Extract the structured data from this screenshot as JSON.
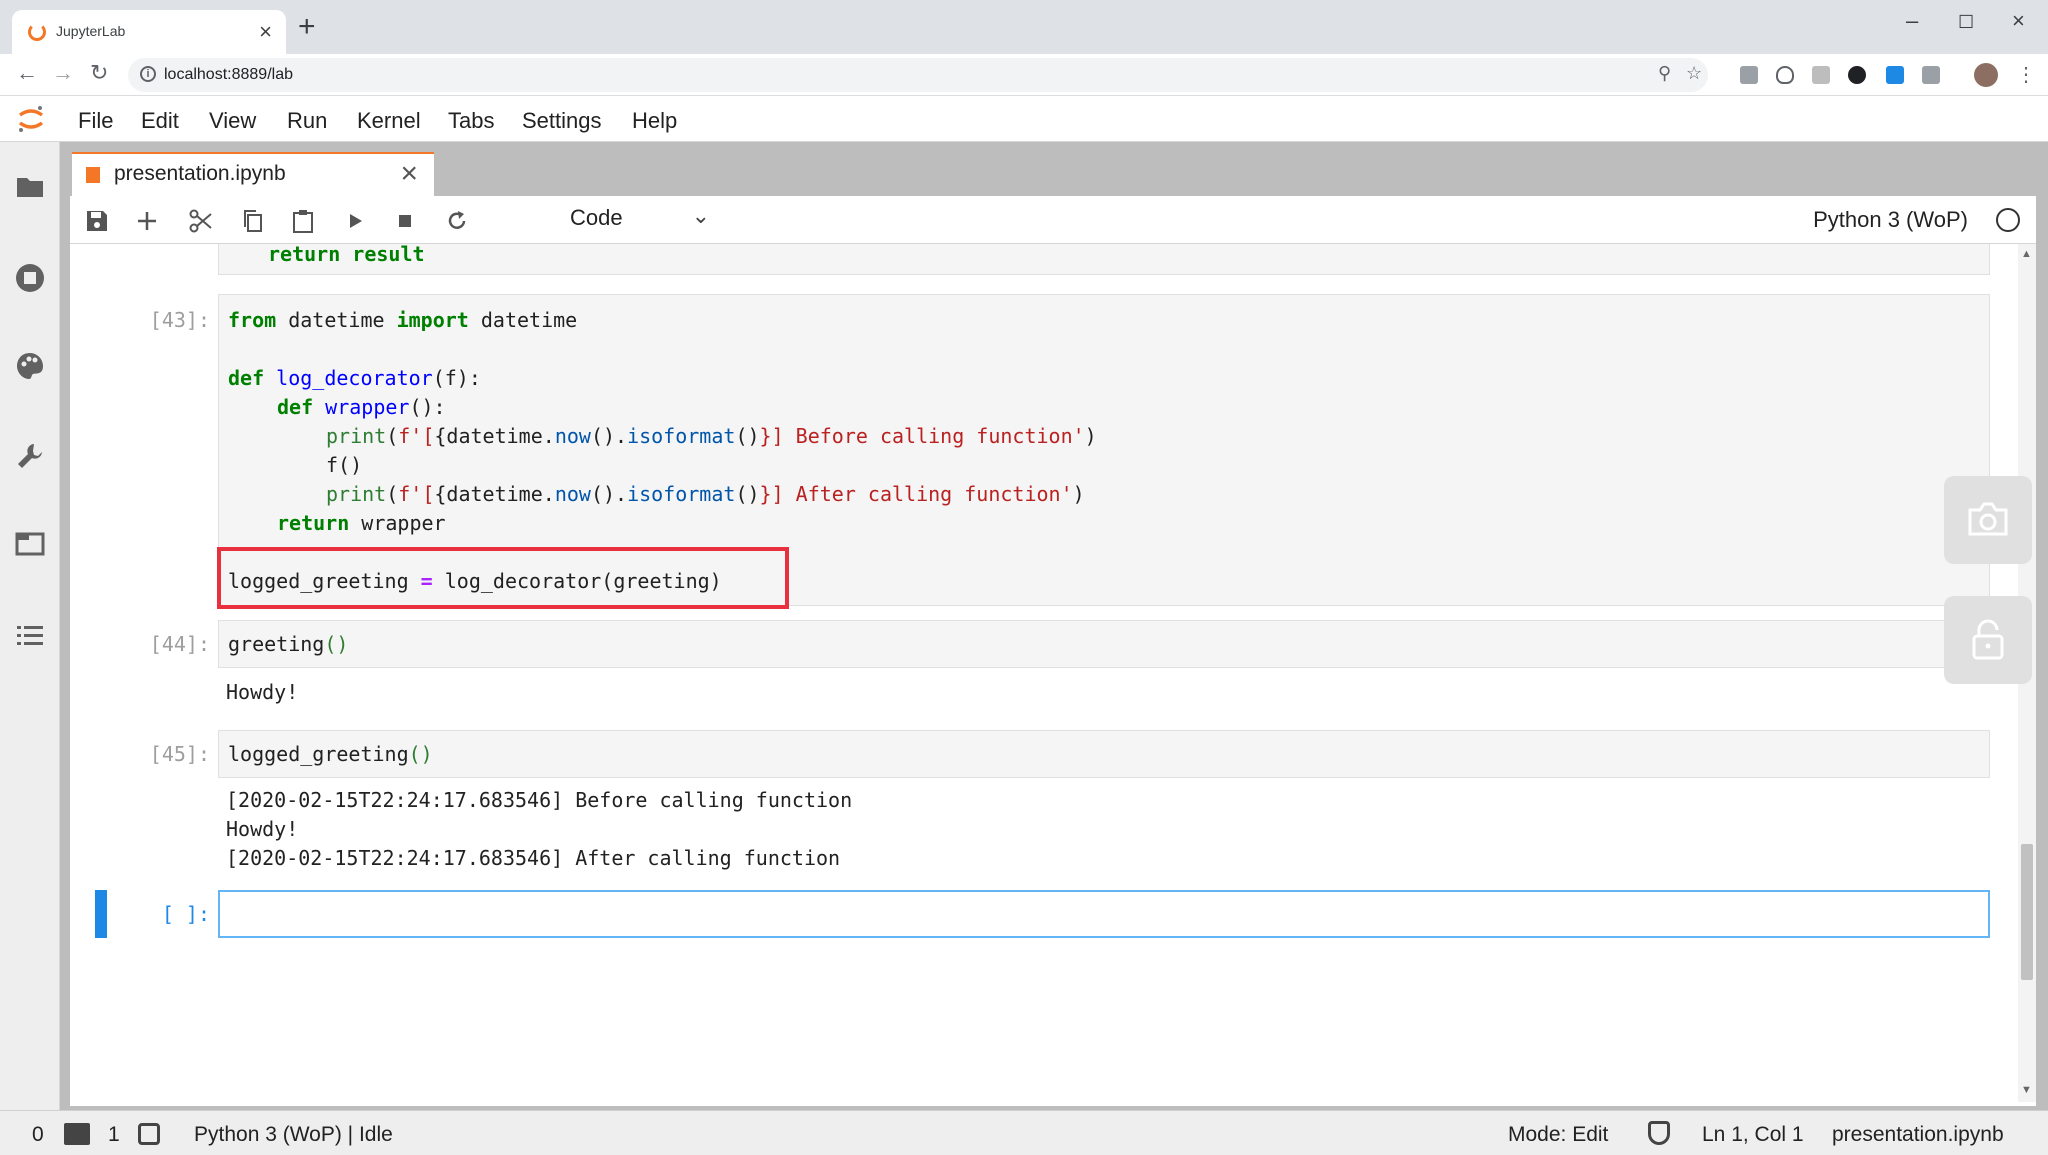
{
  "browser": {
    "tab_title": "JupyterLab",
    "url": "localhost:8889/lab"
  },
  "menubar": {
    "items": [
      "File",
      "Edit",
      "View",
      "Run",
      "Kernel",
      "Tabs",
      "Settings",
      "Help"
    ]
  },
  "document_tab": {
    "title": "presentation.ipynb"
  },
  "toolbar": {
    "cell_type": "Code",
    "kernel_name": "Python 3 (WoP)"
  },
  "cells": {
    "partial_line": "return result",
    "cell43": {
      "prompt": "[43]:",
      "line1": [
        "from",
        " datetime ",
        "import",
        " datetime"
      ],
      "line2": [
        "def",
        " ",
        "log_decorator",
        "(f):"
      ],
      "line3": [
        "def",
        " ",
        "wrapper",
        "():"
      ],
      "line4": [
        "print",
        "(",
        "f'[",
        "{datetime",
        ".",
        "now",
        "().",
        "isoformat",
        "()",
        "}",
        "] Before calling function'",
        ")"
      ],
      "line5": "f()",
      "line6": [
        "print",
        "(",
        "f'[",
        "{datetime",
        ".",
        "now",
        "().",
        "isoformat",
        "()",
        "}",
        "] After calling function'",
        ")"
      ],
      "line7": [
        "return",
        " wrapper"
      ],
      "line8": [
        "logged_greeting ",
        "=",
        " log_decorator(greeting)"
      ]
    },
    "cell44": {
      "prompt": "[44]:",
      "code": "greeting",
      "parens": "()",
      "output": "Howdy!"
    },
    "cell45": {
      "prompt": "[45]:",
      "code": "logged_greeting",
      "parens": "()",
      "output": [
        "[2020-02-15T22:24:17.683546] Before calling function",
        "Howdy!",
        "[2020-02-15T22:24:17.683546] After calling function"
      ]
    },
    "empty_cell": {
      "prompt": "[ ]:"
    }
  },
  "statusbar": {
    "terminals": "0",
    "kernels": "1",
    "kernel_status": "Python 3 (WoP) | Idle",
    "mode": "Mode: Edit",
    "position": "Ln 1, Col 1",
    "filename": "presentation.ipynb"
  },
  "colors": {
    "jupyter_orange": "#f37726",
    "highlight_red": "#e8303f",
    "active_cell_blue": "#1e88e5",
    "keyword_green": "#008000",
    "string_red": "#ba2121"
  }
}
